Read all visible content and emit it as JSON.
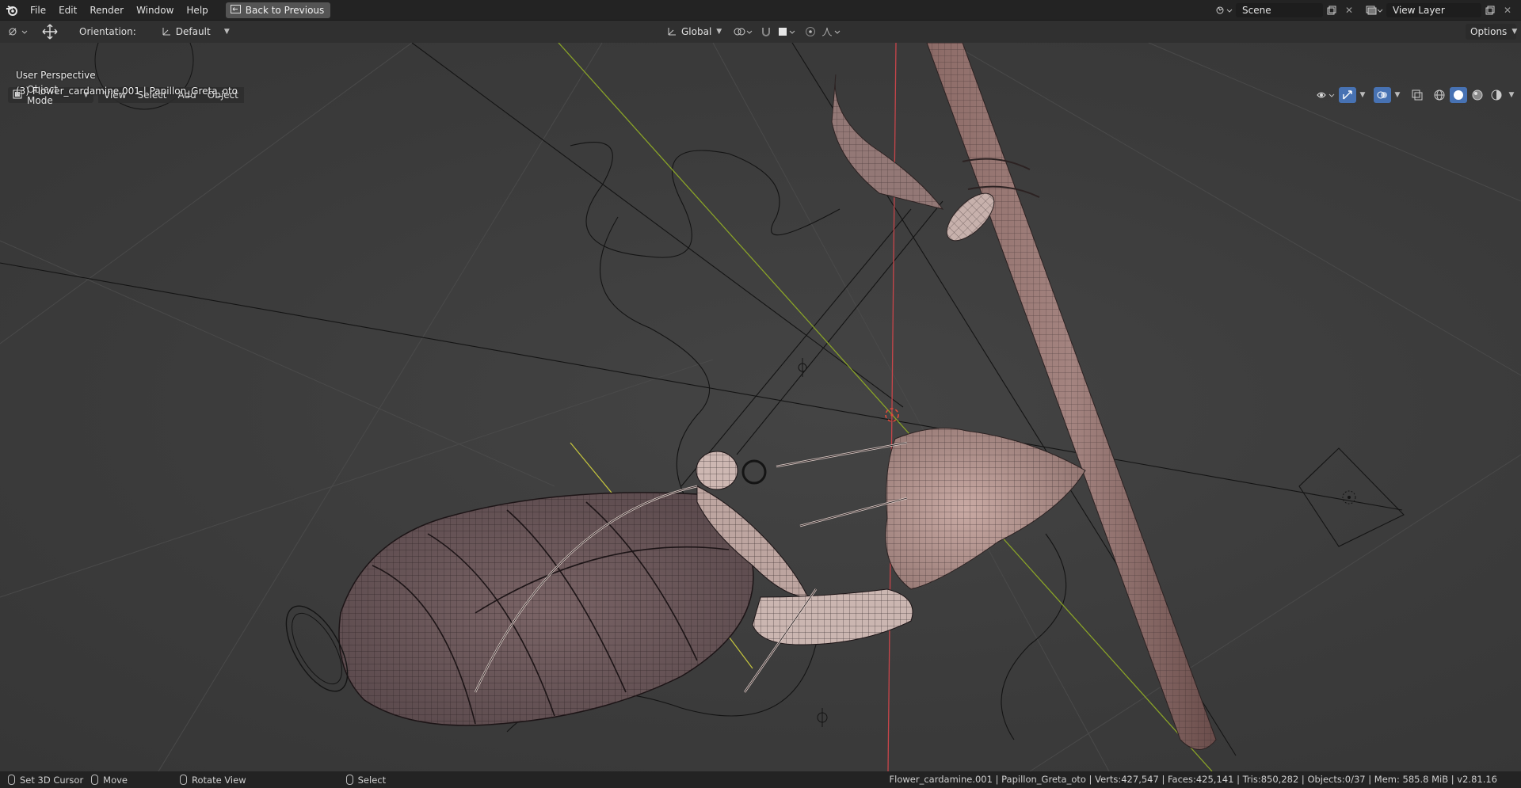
{
  "topbar": {
    "menus": [
      "File",
      "Edit",
      "Render",
      "Window",
      "Help"
    ],
    "back_label": "Back to Previous",
    "scene": "Scene",
    "view_layer": "View Layer"
  },
  "header": {
    "orientation_label": "Orientation:",
    "orientation_value": "Default",
    "transform_orientation": "Global",
    "options_label": "Options"
  },
  "viewport_header": {
    "mode": "Object Mode",
    "menus": [
      "View",
      "Select",
      "Add",
      "Object"
    ]
  },
  "viewport": {
    "perspective": "User Perspective",
    "active_object": "(3) Flower_cardamine.001 | Papillon_Greta_oto"
  },
  "statusbar": {
    "set_cursor": "Set 3D Cursor",
    "move": "Move",
    "rotate": "Rotate View",
    "select": "Select",
    "stats": "Flower_cardamine.001 | Papillon_Greta_oto | Verts:427,547 | Faces:425,141 | Tris:850,282 | Objects:0/37 | Mem: 585.8 MiB | v2.81.16"
  },
  "colors": {
    "axis_x": "#d04a4a",
    "axis_y": "#8fae2b",
    "mesh": "#6e5a5a"
  }
}
